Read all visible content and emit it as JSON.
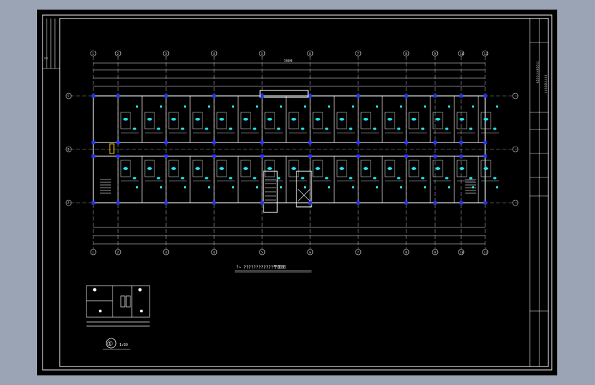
{
  "drawing": {
    "plan_title": "?~ ????????????平面图",
    "detail_number": "①",
    "detail_scale": "1:50",
    "total_length": "54600",
    "axis_labels_top": [
      "1",
      "2",
      "3",
      "4",
      "5",
      "6",
      "7",
      "8",
      "9",
      "10",
      "11"
    ],
    "axis_labels_left": [
      "C",
      "B",
      "A"
    ],
    "title_block_text": [
      "????????????",
      "??????????"
    ],
    "colors": {
      "background": "#000000",
      "viewport": "#9ba4b5",
      "lines": "#ffffff",
      "columns": "#2233ff",
      "fixtures": "#22e5f0",
      "highlight": "#ffd200"
    }
  }
}
